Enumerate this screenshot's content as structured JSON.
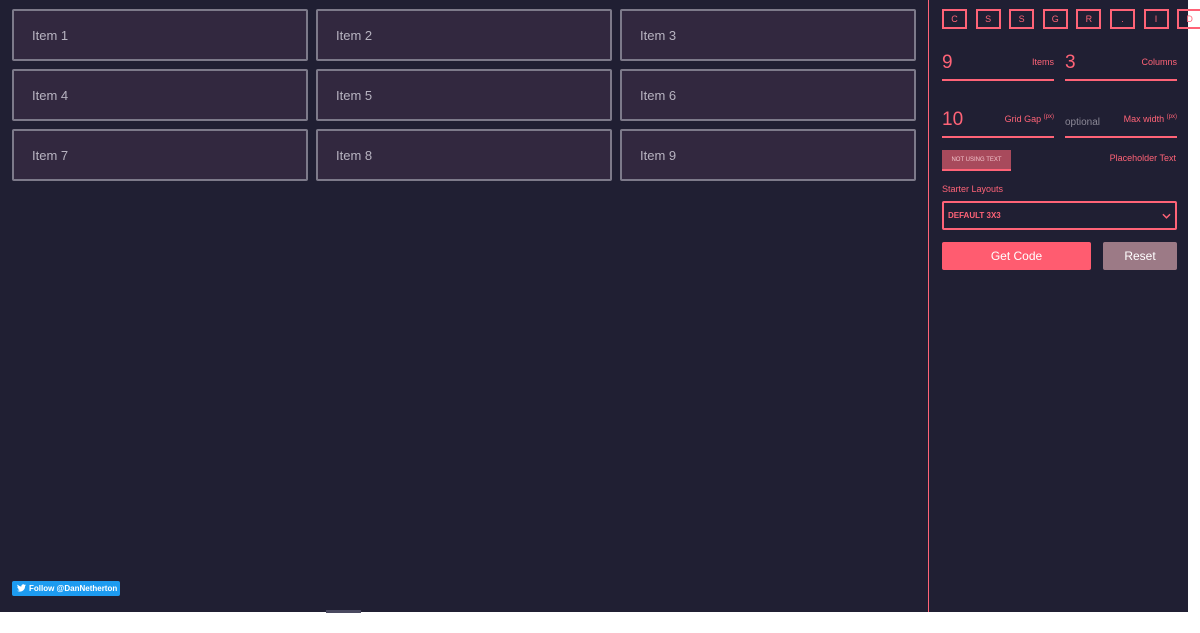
{
  "grid": {
    "items": [
      "Item 1",
      "Item 2",
      "Item 3",
      "Item 4",
      "Item 5",
      "Item 6",
      "Item 7",
      "Item 8",
      "Item 9"
    ]
  },
  "footer": {
    "twitter_label": "Follow @DanNetherton",
    "twitter_icon": "twitter-bird-icon"
  },
  "sidebar": {
    "title_letters": [
      "C",
      "S",
      "S",
      "G",
      "R",
      ".",
      "I",
      "D"
    ],
    "items": {
      "value": "9",
      "label": "Items"
    },
    "columns": {
      "value": "3",
      "label": "Columns"
    },
    "grid_gap": {
      "value": "10",
      "label": "Grid Gap",
      "unit": "(px)"
    },
    "max_width": {
      "placeholder": "optional",
      "label": "Max width",
      "unit": "(px)"
    },
    "text_toggle": {
      "label": "NOT USING TEXT"
    },
    "placeholder_text_label": "Placeholder Text",
    "starter_layouts_label": "Starter Layouts",
    "starter_layout_selected": "DEFAULT 3X3",
    "get_code_label": "Get Code",
    "reset_label": "Reset"
  },
  "colors": {
    "background": "#201f33",
    "accent": "#ff6377",
    "item_bg": "#32283f",
    "item_border": "#7d7a8a",
    "reset_bg": "#9c7a86",
    "twitter_blue": "#1d9bf0"
  }
}
